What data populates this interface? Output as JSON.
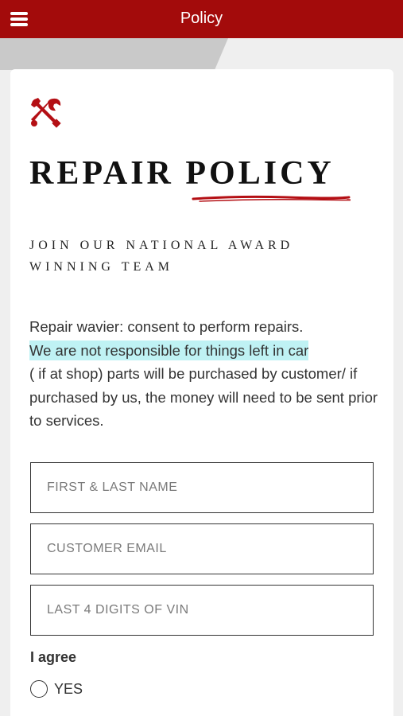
{
  "header": {
    "title": "Policy",
    "menu_icon": "hamburger-menu-icon"
  },
  "colors": {
    "brand_red": "#a30b0b",
    "highlight": "#bff2f4"
  },
  "page": {
    "icon": "wrench-screwdriver-icon",
    "heading": "REPAIR POLICY",
    "subheading_line1": "JOIN OUR NATIONAL AWARD",
    "subheading_line2": "WINNING TEAM",
    "body_line1": "Repair wavier: consent to perform repairs.",
    "body_highlight": "We are not responsible for things left in car",
    "body_rest": "( if at shop) parts will be purchased by customer/ if purchased by us, the money will need to be sent prior to services."
  },
  "form": {
    "name_placeholder": "FIRST & LAST NAME",
    "email_placeholder": "CUSTOMER EMAIL",
    "vin_placeholder": "LAST 4 DIGITS OF VIN",
    "agree_label": "I agree",
    "yes_label": "YES"
  }
}
